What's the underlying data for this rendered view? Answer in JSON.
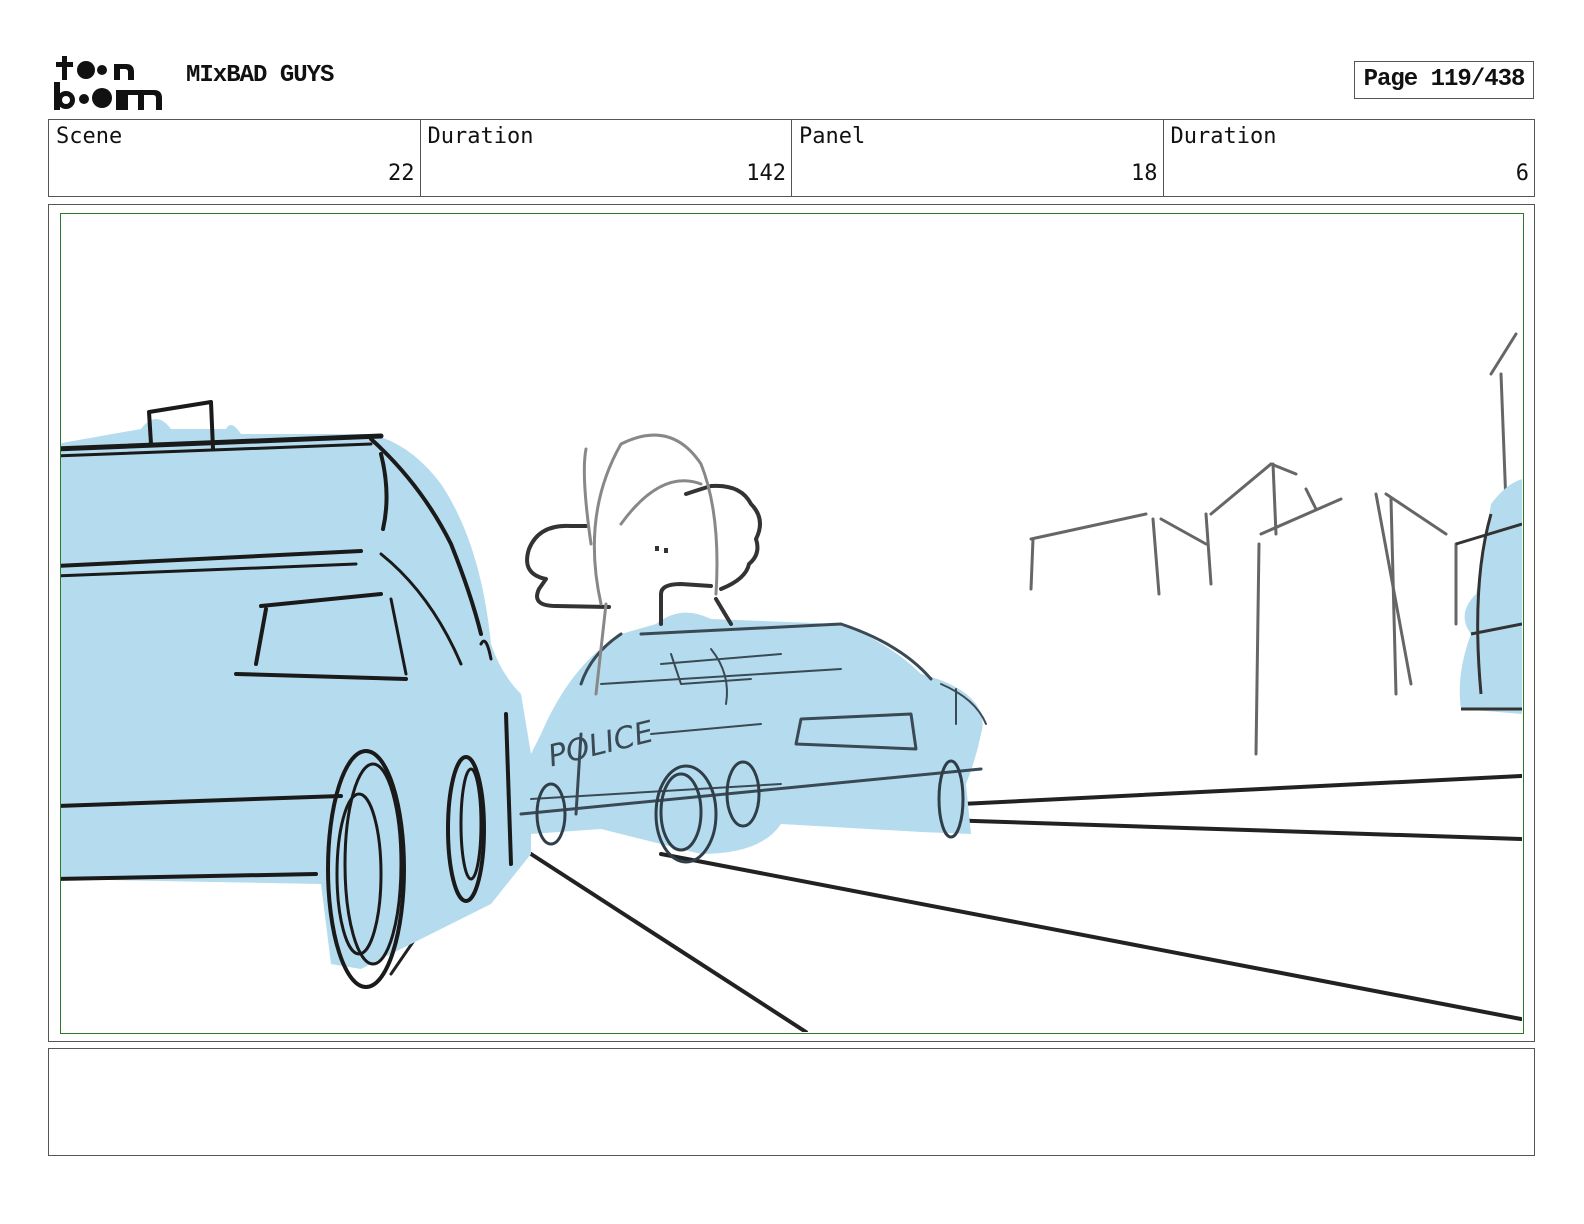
{
  "header": {
    "logo_text": "toon boom",
    "project_title": "MIxBAD GUYS",
    "page_label": "Page 119/438"
  },
  "info": {
    "scene_label": "Scene",
    "scene_value": "22",
    "scene_duration_label": "Duration",
    "scene_duration_value": "142",
    "panel_label": "Panel",
    "panel_value": "18",
    "panel_duration_label": "Duration",
    "panel_duration_value": "6"
  },
  "sketch": {
    "police_text": "POLICE",
    "fill_color": "#b5dcee",
    "line_color": "#222222",
    "frame_color": "#2a7a2a"
  },
  "notes": {
    "text": ""
  }
}
